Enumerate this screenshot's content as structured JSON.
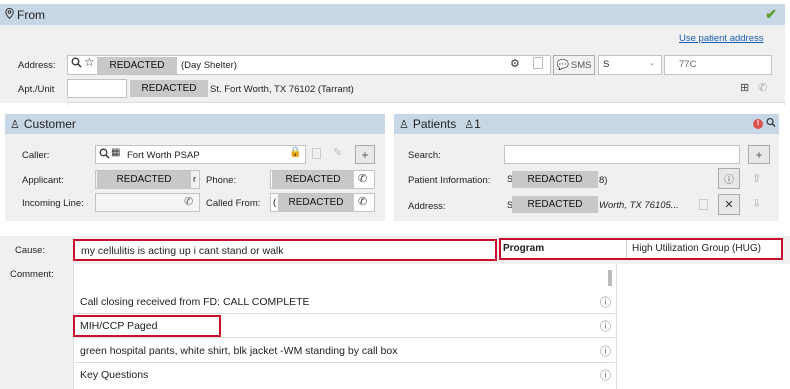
{
  "from": {
    "title": "From",
    "check_icon": "check-icon"
  },
  "address": {
    "use_patient_link": "Use patient address",
    "label": "Address:",
    "value_redacted": "REDACTED",
    "value_suffix": "(Day Shelter)",
    "sms_label": "SMS",
    "direction_value": "S",
    "unit_value": "77C",
    "apt_label": "Apt./Unit",
    "apt_redacted": "REDACTED",
    "apt_suffix": "St. Fort Worth, TX 76102 (Tarrant)"
  },
  "customer": {
    "title": "Customer",
    "caller_label": "Caller:",
    "caller_value": "Fort Worth PSAP",
    "applicant_label": "Applicant:",
    "applicant_redacted": "REDACTED",
    "applicant_tail": "r",
    "phone_label": "Phone:",
    "phone_redacted": "REDACTED",
    "incoming_label": "Incoming Line:",
    "called_from_label": "Called From:",
    "called_from_prefix": "(",
    "called_from_redacted": "REDACTED"
  },
  "patients": {
    "title": "Patients",
    "count": "1",
    "search_label": "Search:",
    "info_label": "Patient Information:",
    "info_prefix": "S",
    "info_redacted": "REDACTED",
    "info_suffix": "8)",
    "address_label": "Address:",
    "address_prefix": "S",
    "address_redacted": "REDACTED",
    "address_suffix": "Worth, TX 76105..."
  },
  "cause": {
    "label": "Cause:",
    "value": "my cellulitis is acting up i cant stand or walk",
    "program_label": "Program",
    "program_value": "High Utilization Group (HUG)"
  },
  "comment": {
    "label": "Comment:",
    "items": [
      "Call closing received from FD: CALL COMPLETE",
      "MIH/CCP Paged",
      "green hospital pants, white shirt, blk jacket -WM standing by call box",
      "Key Questions"
    ]
  },
  "colors": {
    "header": "#c8d7e6",
    "highlight": "#c8102e",
    "link": "#1a5fb4",
    "check": "#5aa02c"
  }
}
